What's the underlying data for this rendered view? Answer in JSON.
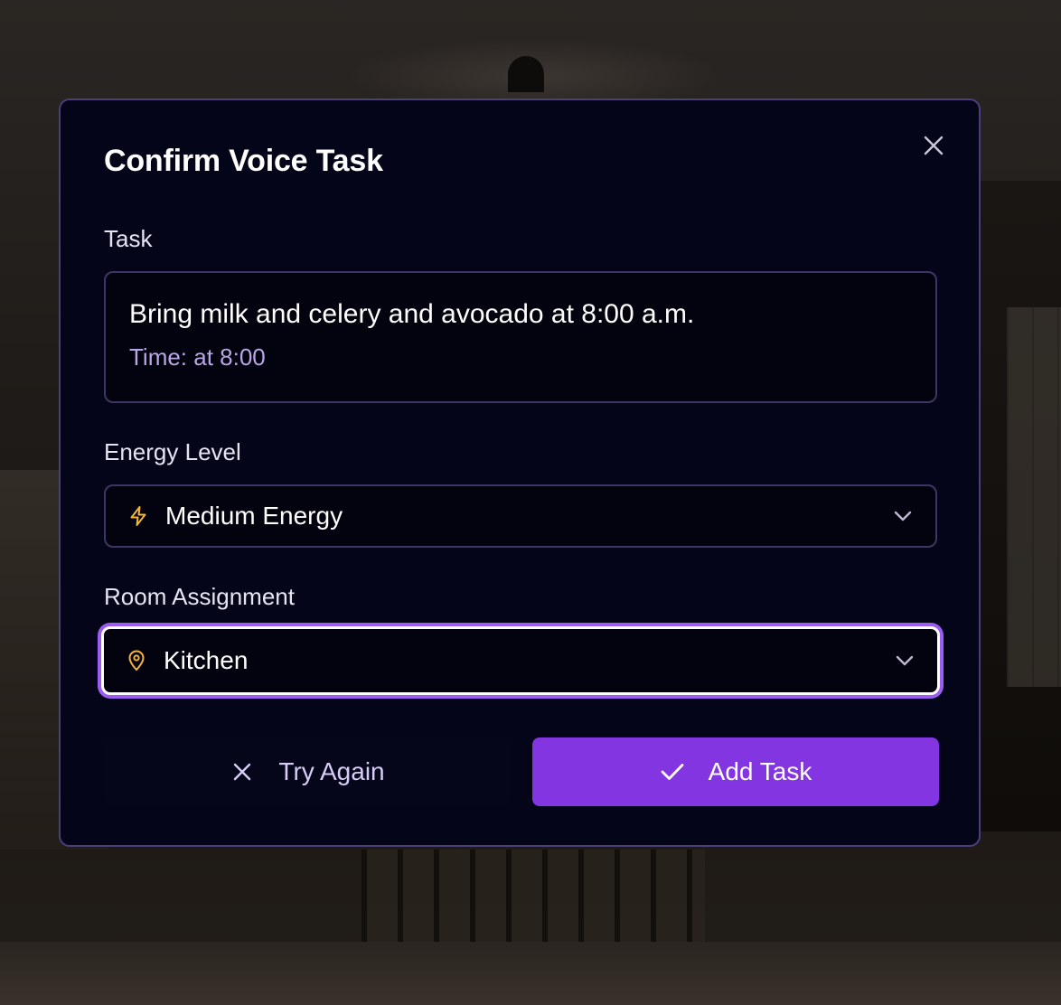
{
  "modal": {
    "title": "Confirm Voice Task",
    "close_icon": "close-icon"
  },
  "task": {
    "label": "Task",
    "text": "Bring milk and celery and avocado at 8:00 a.m.",
    "time": "Time: at 8:00"
  },
  "energy": {
    "label": "Energy Level",
    "value": "Medium Energy",
    "icon": "lightning-icon"
  },
  "room": {
    "label": "Room Assignment",
    "value": "Kitchen",
    "icon": "map-pin-icon"
  },
  "actions": {
    "try_again_label": "Try Again",
    "add_task_label": "Add Task"
  },
  "colors": {
    "accent": "#8335e2",
    "focus_ring": "#9b5cf0",
    "icon_amber": "#f2b53c",
    "modal_bg": "#05051a"
  }
}
